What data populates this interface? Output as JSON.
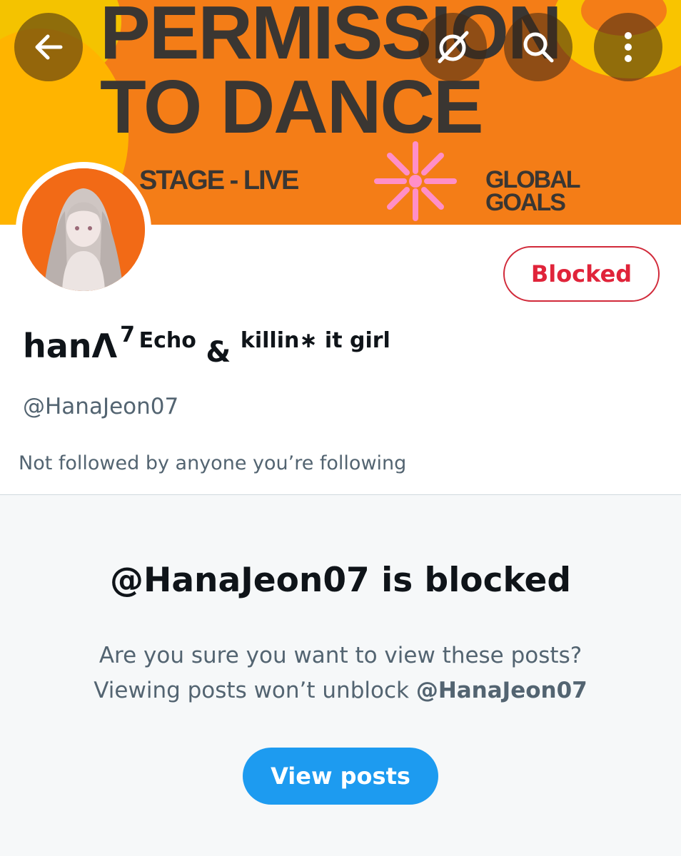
{
  "banner": {
    "title_line1": "PERMISSION",
    "title_line2": "TO DANCE",
    "subtitle": "STAGE - LIVE",
    "goals_line1": "GLOBAL",
    "goals_line2": "GOALS"
  },
  "toolbar": {
    "back_icon": "back-arrow-icon",
    "grok_icon": "grok-icon",
    "search_icon": "search-icon",
    "more_icon": "more-vertical-icon"
  },
  "profile": {
    "name_main": "hanΛ",
    "name_sup": "7",
    "name_echo": "Echo",
    "name_amp": "&",
    "name_rest": "killin∗ it girl",
    "handle": "@HanaJeon07",
    "mutual_text": "Not followed by anyone you’re following",
    "blocked_label": "Blocked"
  },
  "notice": {
    "title": "@HanaJeon07 is blocked",
    "line1": "Are you sure you want to view these posts?",
    "line2_prefix": "Viewing posts won’t unblock ",
    "line2_handle": "@HanaJeon07",
    "button_label": "View posts"
  },
  "colors": {
    "accent": "#1d9bf0",
    "blocked_red": "#e0243a",
    "banner_orange": "#f47d17",
    "text_primary": "#0f1419",
    "text_secondary": "#536471"
  }
}
